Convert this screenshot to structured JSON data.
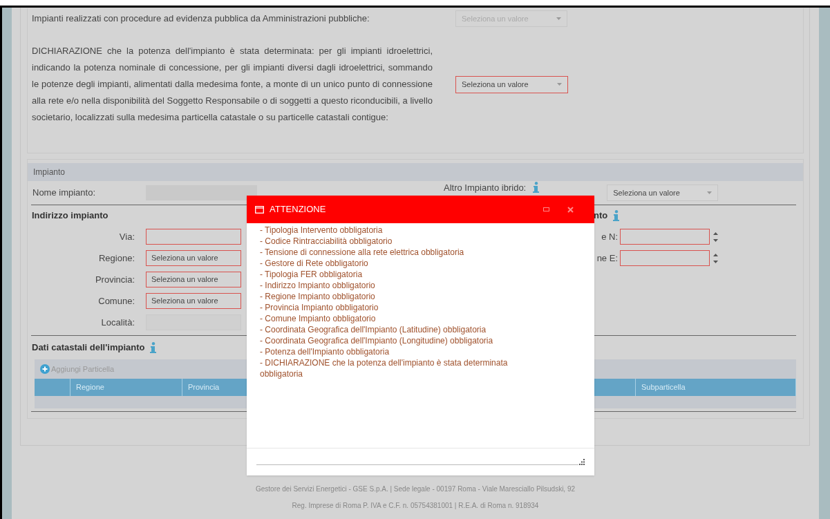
{
  "top_section": {
    "public_procedure": {
      "label": "Impianti realizzati con procedure ad evidenza pubblica da Amministrazioni pubbliche:",
      "select": {
        "value": "Seleziona un valore",
        "disabled": true,
        "invalid": false
      }
    },
    "declaration": {
      "label": "DICHIARAZIONE che la potenza dell'impianto è stata determinata: per gli impianti idroelettrici, indicando la potenza nominale di concessione, per gli impianti diversi dagli idroelettrici, sommando le potenze degli impianti, alimentati dalla medesima fonte, a monte di un unico punto di connessione alla rete e/o nella disponibilità del Soggetto Responsabile o di soggetti a questo riconducibili, a livello societario, localizzati sulla medesima particella catastale o su particelle catastali contigue:",
      "select": {
        "value": "Seleziona un valore",
        "disabled": false,
        "invalid": true
      }
    }
  },
  "impianto": {
    "title": "Impianto",
    "name_label": "Nome impianto:",
    "hybrid_label": "Altro Impianto ibrido:",
    "hybrid_select": {
      "value": "Seleziona un valore",
      "disabled": false,
      "invalid": false
    },
    "address": {
      "heading": "Indirizzo impianto",
      "fields": [
        {
          "label": "Via:",
          "kind": "text",
          "invalid": true
        },
        {
          "label": "Regione:",
          "kind": "select",
          "value": "Seleziona un valore",
          "invalid": true
        },
        {
          "label": "Provincia:",
          "kind": "select",
          "value": "Seleziona un valore",
          "invalid": true
        },
        {
          "label": "Comune:",
          "kind": "select",
          "value": "Seleziona un valore",
          "invalid": true
        },
        {
          "label": "Località:",
          "kind": "text",
          "invalid": false
        }
      ]
    },
    "coordinates": {
      "heading": "nto",
      "fields": [
        {
          "label": "e N:",
          "invalid": true
        },
        {
          "label": "ne E:",
          "invalid": true
        }
      ]
    },
    "cadastral": {
      "heading": "Dati catastali dell'impianto",
      "add_button": "Aggiungi Particella",
      "columns": [
        "Regione",
        "Provincia",
        "Subparticella"
      ]
    }
  },
  "dialog": {
    "title": "ATTENZIONE",
    "messages": [
      "- Tipologia Intervento obbligatoria",
      "- Codice Rintracciabilità obbligatorio",
      "- Tensione di connessione alla rete elettrica obbligatoria",
      "- Gestore di Rete obbligatorio",
      "- Tipologia FER obbligatoria",
      "- Indirizzo Impianto obbligatorio",
      "- Regione Impianto obbligatorio",
      "- Provincia Impianto obbligatorio",
      "- Comune Impianto obbligatorio",
      "- Coordinata Geografica dell'Impianto (Latitudine) obbligatoria",
      "- Coordinata Geografica dell'Impianto (Longitudine) obbligatoria",
      "- Potenza dell'Impianto obbligatoria",
      "- DICHIARAZIONE che la potenza dell'impianto è stata determinata obbligatoria"
    ]
  },
  "footer": [
    "Gestore dei Servizi Energetici - GSE S.p.A. | Sede legale - 00197 Roma - Viale Maresciallo Pilsudski, 92",
    "Reg. Imprese di Roma P. IVA e C.F. n. 05754381001 | R.E.A. di Roma n. 918934"
  ]
}
